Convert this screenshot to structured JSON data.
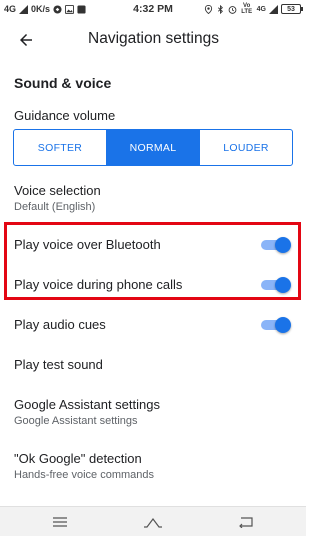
{
  "status_bar": {
    "network": "4G",
    "speed": "0K/s",
    "time": "4:32 PM",
    "lte_label": "Vo LTE",
    "data_label": "4G",
    "battery_level": "53"
  },
  "header": {
    "title": "Navigation settings"
  },
  "section": {
    "title": "Sound & voice"
  },
  "guidance_volume": {
    "label": "Guidance volume",
    "options": [
      "SOFTER",
      "NORMAL",
      "LOUDER"
    ],
    "selected": "NORMAL"
  },
  "settings": {
    "voice_selection": {
      "title": "Voice selection",
      "subtitle": "Default (English)"
    },
    "bluetooth": {
      "title": "Play voice over Bluetooth",
      "enabled": true
    },
    "phone_calls": {
      "title": "Play voice during phone calls",
      "enabled": true
    },
    "audio_cues": {
      "title": "Play audio cues",
      "enabled": true
    },
    "test_sound": {
      "title": "Play test sound"
    },
    "assistant": {
      "title": "Google Assistant settings",
      "subtitle": "Google Assistant settings"
    },
    "ok_google": {
      "title": "\"Ok Google\" detection",
      "subtitle": "Hands-free voice commands"
    }
  },
  "colors": {
    "accent": "#1a73e8",
    "highlight_border": "#e30613"
  }
}
